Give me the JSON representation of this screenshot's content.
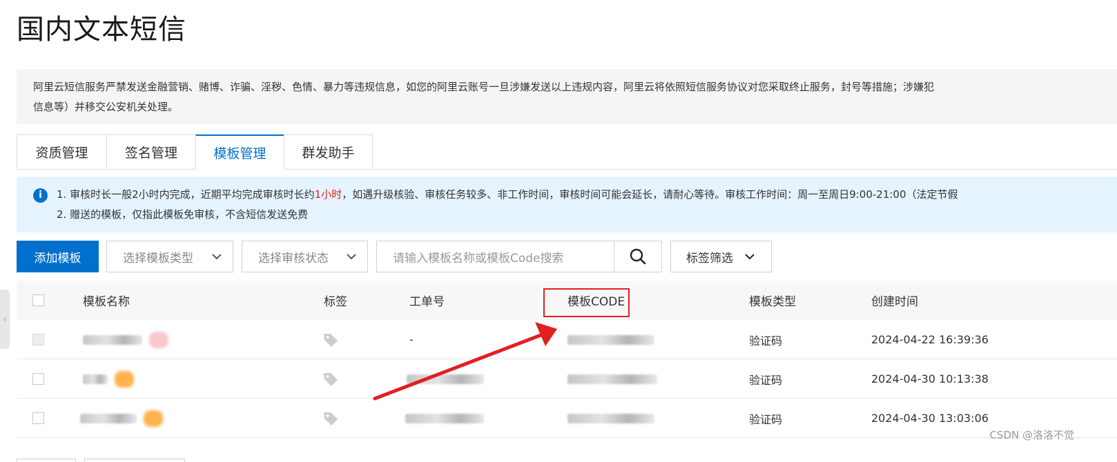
{
  "page": {
    "title": "国内文本短信"
  },
  "notice": {
    "line1": "阿里云短信服务严禁发送金融营销、赌博、诈骗、淫秽、色情、暴力等违规信息，如您的阿里云账号一旦涉嫌发送以上违规内容，阿里云将依照短信服务协议对您采取终止服务，封号等措施；涉嫌犯",
    "line2": "信息等）并移交公安机关处理。"
  },
  "tabs": [
    {
      "label": "资质管理",
      "active": false
    },
    {
      "label": "签名管理",
      "active": false
    },
    {
      "label": "模板管理",
      "active": true
    },
    {
      "label": "群发助手",
      "active": false
    }
  ],
  "info": {
    "line1_pre": "1. 审核时长一般2小时内完成，近期平均完成审核时长约",
    "line1_highlight": "1小时",
    "line1_post": "，如遇升级核验、审核任务较多、非工作时间，审核时间可能会延长，请耐心等待。审核工作时间：周一至周日9:00-21:00（法定节假",
    "line2": "2. 赠送的模板，仅指此模板免审核，不含短信发送免费",
    "highlight_color": "#e02020"
  },
  "toolbar": {
    "add_label": "添加模板",
    "type_select": "选择模板类型",
    "status_select": "选择审核状态",
    "search_placeholder": "请输入模板名称或模板Code搜索",
    "tag_filter": "标签筛选"
  },
  "table": {
    "headers": {
      "name": "模板名称",
      "tag": "标签",
      "ticket": "工单号",
      "code": "模板CODE",
      "type": "模板类型",
      "created": "创建时间"
    },
    "rows": [
      {
        "ticket": "-",
        "type": "验证码",
        "created": "2024-04-22 16:39:36"
      },
      {
        "ticket": "",
        "type": "验证码",
        "created": "2024-04-30 10:13:38"
      },
      {
        "ticket": "",
        "type": "验证码",
        "created": "2024-04-30 13:03:06"
      }
    ]
  },
  "watermark": "CSDN @洛洛不觉",
  "colors": {
    "primary": "#0070cc",
    "annotation_red": "#e02020",
    "info_bg": "#e5f3ff"
  }
}
